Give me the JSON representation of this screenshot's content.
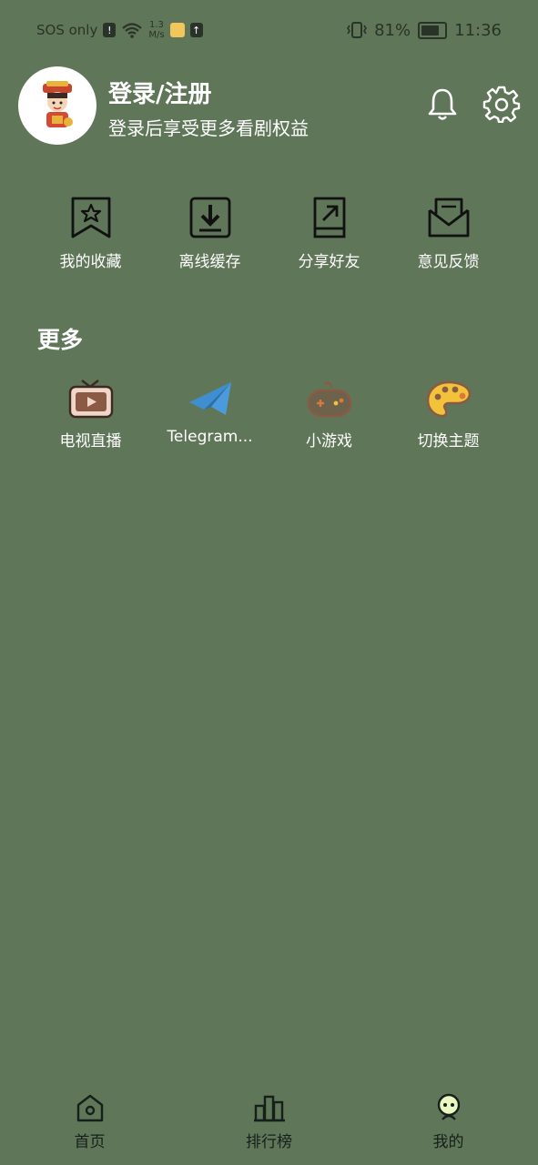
{
  "status_bar": {
    "carrier": "SOS only",
    "net_speed_value": "1.3",
    "net_speed_unit": "M/s",
    "battery": "81%",
    "time": "11:36"
  },
  "profile": {
    "title": "登录/注册",
    "subtitle": "登录后享受更多看剧权益"
  },
  "quick_actions": [
    {
      "label": "我的收藏",
      "icon": "bookmark-star-icon"
    },
    {
      "label": "离线缓存",
      "icon": "download-icon"
    },
    {
      "label": "分享好友",
      "icon": "share-icon"
    },
    {
      "label": "意见反馈",
      "icon": "feedback-mail-icon"
    }
  ],
  "more": {
    "title": "更多",
    "items": [
      {
        "label": "电视直播",
        "icon": "tv-icon"
      },
      {
        "label": "Telegram...",
        "icon": "telegram-icon"
      },
      {
        "label": "小游戏",
        "icon": "gamepad-icon"
      },
      {
        "label": "切换主题",
        "icon": "palette-icon"
      }
    ]
  },
  "bottom_nav": [
    {
      "label": "首页",
      "icon": "home-icon"
    },
    {
      "label": "排行榜",
      "icon": "ranking-icon"
    },
    {
      "label": "我的",
      "icon": "profile-icon",
      "active": true
    }
  ],
  "colors": {
    "background": "#5f7659",
    "icon_dark": "#111111",
    "telegram_blue": "#3e8ed0",
    "tv_brown": "#8b5a45",
    "game_orange": "#d9793a",
    "palette_yellow": "#f2c23a"
  }
}
